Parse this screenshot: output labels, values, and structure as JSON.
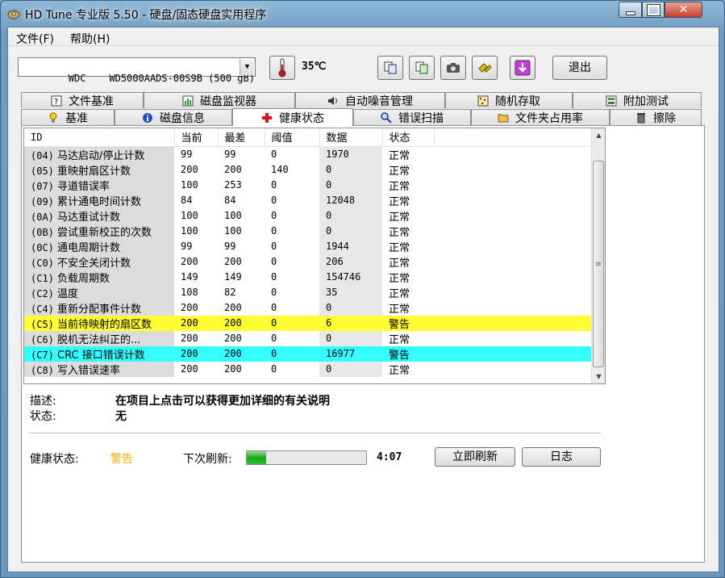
{
  "window": {
    "title": "HD Tune 专业版 5.50 - 硬盘/固态硬盘实用程序"
  },
  "menu": {
    "items": [
      "文件(F)",
      "帮助(H)"
    ]
  },
  "toolbar": {
    "drive": "WDC    WD5000AADS-00S9B (500 gB)",
    "temperature": "35℃",
    "exit_label": "退出",
    "icons": [
      "thermometer-icon",
      "copy-text-icon",
      "copy-screen-icon",
      "screenshot-icon",
      "options-icon",
      "save-icon"
    ]
  },
  "tabs": {
    "row1": [
      "文件基准",
      "磁盘监视器",
      "自动噪音管理",
      "随机存取",
      "附加测试"
    ],
    "row2": [
      "基准",
      "磁盘信息",
      "健康状态",
      "错误扫描",
      "文件夹占用率",
      "擦除"
    ],
    "active": "健康状态"
  },
  "table": {
    "headers": [
      "ID",
      "当前",
      "最差",
      "阈值",
      "数据",
      "状态"
    ],
    "rows": [
      {
        "id": "(04)",
        "name": "马达启动/停止计数",
        "cur": "99",
        "worst": "99",
        "thr": "0",
        "data": "1970",
        "status": "正常",
        "hl": ""
      },
      {
        "id": "(05)",
        "name": "重映射扇区计数",
        "cur": "200",
        "worst": "200",
        "thr": "140",
        "data": "0",
        "status": "正常",
        "hl": ""
      },
      {
        "id": "(07)",
        "name": "寻道错误率",
        "cur": "100",
        "worst": "253",
        "thr": "0",
        "data": "0",
        "status": "正常",
        "hl": ""
      },
      {
        "id": "(09)",
        "name": "累计通电时间计数",
        "cur": "84",
        "worst": "84",
        "thr": "0",
        "data": "12048",
        "status": "正常",
        "hl": ""
      },
      {
        "id": "(0A)",
        "name": "马达重试计数",
        "cur": "100",
        "worst": "100",
        "thr": "0",
        "data": "0",
        "status": "正常",
        "hl": ""
      },
      {
        "id": "(0B)",
        "name": "尝试重新校正的次数",
        "cur": "100",
        "worst": "100",
        "thr": "0",
        "data": "0",
        "status": "正常",
        "hl": ""
      },
      {
        "id": "(0C)",
        "name": "通电周期计数",
        "cur": "99",
        "worst": "99",
        "thr": "0",
        "data": "1944",
        "status": "正常",
        "hl": ""
      },
      {
        "id": "(C0)",
        "name": "不安全关闭计数",
        "cur": "200",
        "worst": "200",
        "thr": "0",
        "data": "206",
        "status": "正常",
        "hl": ""
      },
      {
        "id": "(C1)",
        "name": "负载周期数",
        "cur": "149",
        "worst": "149",
        "thr": "0",
        "data": "154746",
        "status": "正常",
        "hl": ""
      },
      {
        "id": "(C2)",
        "name": "温度",
        "cur": "108",
        "worst": "82",
        "thr": "0",
        "data": "35",
        "status": "正常",
        "hl": ""
      },
      {
        "id": "(C4)",
        "name": "重新分配事件计数",
        "cur": "200",
        "worst": "200",
        "thr": "0",
        "data": "0",
        "status": "正常",
        "hl": ""
      },
      {
        "id": "(C5)",
        "name": "当前待映射的扇区数",
        "cur": "200",
        "worst": "200",
        "thr": "0",
        "data": "6",
        "status": "警告",
        "hl": "yellow"
      },
      {
        "id": "(C6)",
        "name": "脱机无法纠正的...",
        "cur": "200",
        "worst": "200",
        "thr": "0",
        "data": "0",
        "status": "正常",
        "hl": ""
      },
      {
        "id": "(C7)",
        "name": "CRC 接口错误计数",
        "cur": "200",
        "worst": "200",
        "thr": "0",
        "data": "16977",
        "status": "警告",
        "hl": "cyan"
      },
      {
        "id": "(C8)",
        "name": "写入错误速率",
        "cur": "200",
        "worst": "200",
        "thr": "0",
        "data": "0",
        "status": "正常",
        "hl": ""
      }
    ]
  },
  "details": {
    "desc_label": "描述:",
    "desc_value": "在项目上点击可以获得更加详细的有关说明",
    "status_label": "状态:",
    "status_value": "无"
  },
  "footer": {
    "health_label": "健康状态:",
    "health_value": "警告",
    "refresh_label": "下次刷新:",
    "progress_fraction": 0.16,
    "countdown": "4:07",
    "refresh_button": "立即刷新",
    "log_button": "日志"
  },
  "colors": {
    "warning_text": "#f0b000",
    "highlight_yellow": "#ffff33",
    "highlight_cyan": "#33ffff"
  }
}
